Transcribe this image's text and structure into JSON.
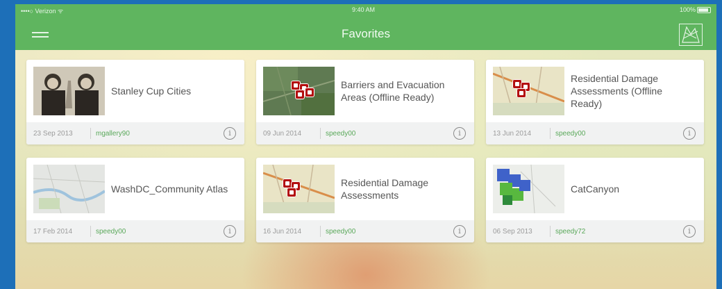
{
  "status_bar": {
    "carrier": "••••○ Verizon ᯤ",
    "time": "9:40 AM",
    "battery": "100%"
  },
  "header": {
    "title": "Favorites",
    "menu_icon": "hamburger-menu-icon",
    "map_icon": "map-gallery-icon"
  },
  "cards": [
    {
      "title": "Stanley Cup Cities",
      "date": "23 Sep 2013",
      "owner": "mgallery90"
    },
    {
      "title": "Barriers and Evacuation Areas (Offline Ready)",
      "date": "09 Jun 2014",
      "owner": "speedy00"
    },
    {
      "title": "Residential Damage Assessments (Offline Ready)",
      "date": "13 Jun 2014",
      "owner": "speedy00"
    },
    {
      "title": "WashDC_Community Atlas",
      "date": "17 Feb 2014",
      "owner": "speedy00"
    },
    {
      "title": "Residential Damage Assessments",
      "date": "16 Jun 2014",
      "owner": "speedy00"
    },
    {
      "title": "CatCanyon",
      "date": "06 Sep 2013",
      "owner": "speedy72"
    }
  ],
  "info_icon_label": "i"
}
